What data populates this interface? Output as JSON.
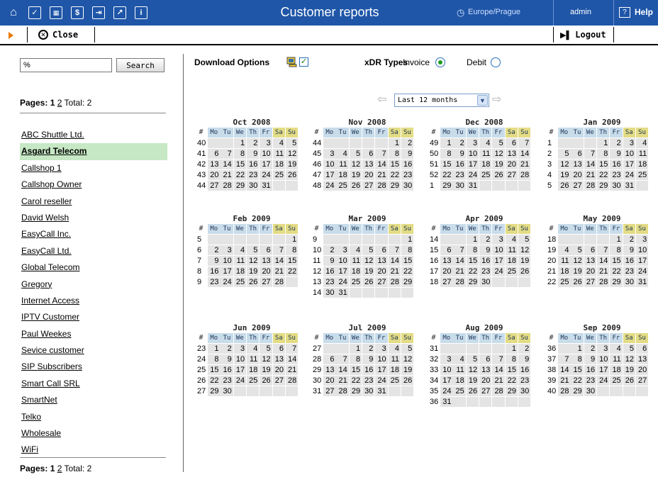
{
  "header": {
    "title": "Customer reports",
    "timezone": "Europe/Prague",
    "user": "admin",
    "help_label": "Help",
    "icons": [
      "home-icon",
      "checkbox-icon",
      "rates-icon",
      "billing-icon",
      "export-icon",
      "statistics-icon",
      "info-icon"
    ]
  },
  "toolbar": {
    "close_label": "Close",
    "logout_label": "Logout"
  },
  "sidebar": {
    "search_value": "%",
    "search_button": "Search",
    "pages_label": "Pages:",
    "current_page": "1",
    "next_page": "2",
    "total_label": "Total: 2",
    "customers": [
      "ABC Shuttle Ltd.",
      "Asgard Telecom",
      "Callshop 1",
      "Callshop Owner",
      "Carol reseller",
      "David Welsh",
      "EasyCall Inc.",
      "EasyCall Ltd.",
      "Global Telecom",
      "Gregory",
      "Internet Access",
      "IPTV Customer",
      "Paul Weekes",
      "Sevice customer",
      "SIP Subscribers",
      "Smart Call SRL",
      "SmartNet",
      "Telko",
      "Wholesale",
      "WiFi"
    ],
    "selected_customer": "Asgard Telecom"
  },
  "options": {
    "download_label": "Download Options",
    "download_checked": true,
    "xdr_label": "xDR Types",
    "invoice_label": "Invoice",
    "debit_label": "Debit",
    "xdr_selected": "Invoice"
  },
  "range": {
    "value": "Last 12 months"
  },
  "calendar": {
    "weekday_headers": [
      "#",
      "Mo",
      "Tu",
      "We",
      "Th",
      "Fr",
      "Sa",
      "Su"
    ],
    "months": [
      {
        "title": "Oct 2008",
        "first_wd": 2,
        "days": 31,
        "weeks": [
          40,
          41,
          42,
          43,
          44
        ]
      },
      {
        "title": "Nov 2008",
        "first_wd": 5,
        "days": 30,
        "weeks": [
          44,
          45,
          46,
          47,
          48
        ]
      },
      {
        "title": "Dec 2008",
        "first_wd": 0,
        "days": 31,
        "weeks": [
          49,
          50,
          51,
          52,
          1
        ]
      },
      {
        "title": "Jan 2009",
        "first_wd": 3,
        "days": 31,
        "weeks": [
          1,
          2,
          3,
          4,
          5
        ]
      },
      {
        "title": "Feb 2009",
        "first_wd": 6,
        "days": 28,
        "weeks": [
          5,
          6,
          7,
          8,
          9
        ]
      },
      {
        "title": "Mar 2009",
        "first_wd": 6,
        "days": 31,
        "weeks": [
          9,
          10,
          11,
          12,
          13,
          14
        ]
      },
      {
        "title": "Apr 2009",
        "first_wd": 2,
        "days": 30,
        "weeks": [
          14,
          15,
          16,
          17,
          18
        ]
      },
      {
        "title": "May 2009",
        "first_wd": 4,
        "days": 31,
        "weeks": [
          18,
          19,
          20,
          21,
          22
        ]
      },
      {
        "title": "Jun 2009",
        "first_wd": 0,
        "days": 30,
        "weeks": [
          23,
          24,
          25,
          26,
          27
        ]
      },
      {
        "title": "Jul 2009",
        "first_wd": 2,
        "days": 31,
        "weeks": [
          27,
          28,
          29,
          30,
          31
        ]
      },
      {
        "title": "Aug 2009",
        "first_wd": 5,
        "days": 31,
        "weeks": [
          31,
          32,
          33,
          34,
          35,
          36
        ]
      },
      {
        "title": "Sep 2009",
        "first_wd": 1,
        "days": 30,
        "weeks": [
          36,
          37,
          38,
          39,
          40
        ]
      }
    ]
  }
}
